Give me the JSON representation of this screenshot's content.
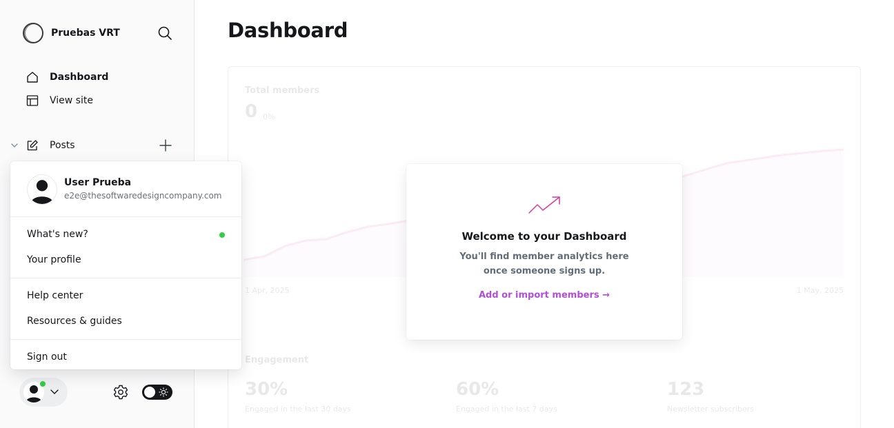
{
  "sidebar": {
    "site_name": "Pruebas VRT",
    "nav": {
      "dashboard": "Dashboard",
      "view_site": "View site",
      "posts": "Posts"
    }
  },
  "user_menu": {
    "name": "User Prueba",
    "email": "e2e@thesoftwaredesigncompany.com",
    "items": {
      "whats_new": "What's new?",
      "your_profile": "Your profile",
      "help_center": "Help center",
      "resources": "Resources & guides",
      "sign_out": "Sign out"
    }
  },
  "main": {
    "title": "Dashboard",
    "total_members": {
      "label": "Total members",
      "value": "0",
      "change": "0%"
    },
    "chart": {
      "start_label": "1 Apr, 2025",
      "end_label": "1 May, 2025"
    },
    "engagement": {
      "label": "Engagement",
      "stats": [
        {
          "value": "30%",
          "caption": "Engaged in the last 30 days"
        },
        {
          "value": "60%",
          "caption": "Engaged in the last 7 days"
        },
        {
          "value": "123",
          "caption": "Newsletter subscribers"
        }
      ]
    },
    "welcome": {
      "title": "Welcome to your Dashboard",
      "text": "You'll find member analytics here once someone signs up.",
      "link": "Add or import members →"
    }
  },
  "colors": {
    "accent": "#b24ed9",
    "trend_icon": "#d63a9a",
    "online": "#30cf43",
    "chart_fill": "#f5d3ee"
  }
}
